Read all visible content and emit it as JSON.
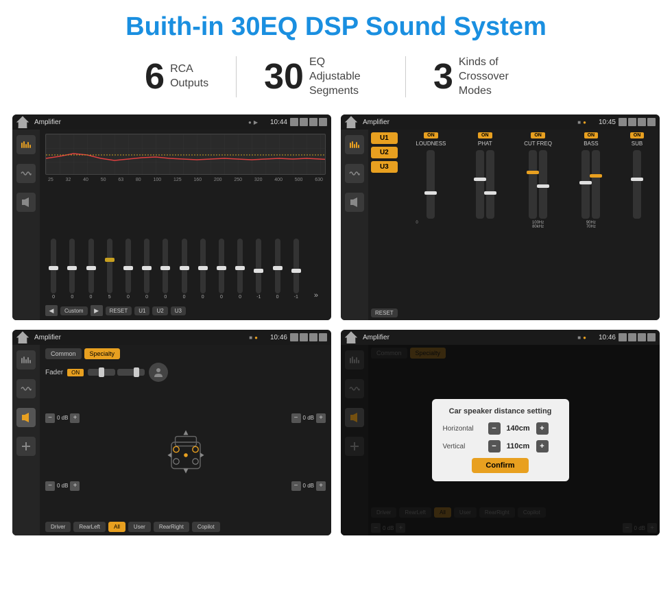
{
  "title": "Buith-in 30EQ DSP Sound System",
  "stats": [
    {
      "number": "6",
      "label": "RCA\nOutputs"
    },
    {
      "number": "30",
      "label": "EQ Adjustable\nSegments"
    },
    {
      "number": "3",
      "label": "Kinds of\nCrossover Modes"
    }
  ],
  "screens": [
    {
      "id": "eq-screen",
      "status": {
        "app": "Amplifier",
        "time": "10:44"
      },
      "eq_labels": [
        "25",
        "32",
        "40",
        "50",
        "63",
        "80",
        "100",
        "125",
        "160",
        "200",
        "250",
        "320",
        "400",
        "500",
        "630"
      ],
      "eq_values": [
        "0",
        "0",
        "0",
        "5",
        "0",
        "0",
        "0",
        "0",
        "0",
        "0",
        "0",
        "-1",
        "0",
        "-1"
      ],
      "controls": [
        "Custom",
        "RESET",
        "U1",
        "U2",
        "U3"
      ]
    },
    {
      "id": "crossover-screen",
      "status": {
        "app": "Amplifier",
        "time": "10:45"
      },
      "u_buttons": [
        "U1",
        "U2",
        "U3"
      ],
      "crossover_cols": [
        "LOUDNESS",
        "PHAT",
        "CUT FREQ",
        "BASS",
        "SUB"
      ],
      "reset_label": "RESET"
    },
    {
      "id": "fader-screen",
      "status": {
        "app": "Amplifier",
        "time": "10:46"
      },
      "tabs": [
        "Common",
        "Specialty"
      ],
      "fader_label": "Fader",
      "fader_on": "ON",
      "speaker_buttons": [
        "Driver",
        "RearLeft",
        "All",
        "User",
        "RearRight",
        "Copilot"
      ],
      "db_values": [
        "0 dB",
        "0 dB",
        "0 dB",
        "0 dB"
      ]
    },
    {
      "id": "dialog-screen",
      "status": {
        "app": "Amplifier",
        "time": "10:46"
      },
      "dialog": {
        "title": "Car speaker distance setting",
        "horizontal_label": "Horizontal",
        "horizontal_value": "140cm",
        "vertical_label": "Vertical",
        "vertical_value": "110cm",
        "confirm_label": "Confirm"
      },
      "speaker_buttons": [
        "Driver",
        "RearLeft",
        "All",
        "User",
        "RearRight",
        "Copilot"
      ],
      "db_values": [
        "0 dB",
        "0 dB"
      ]
    }
  ]
}
